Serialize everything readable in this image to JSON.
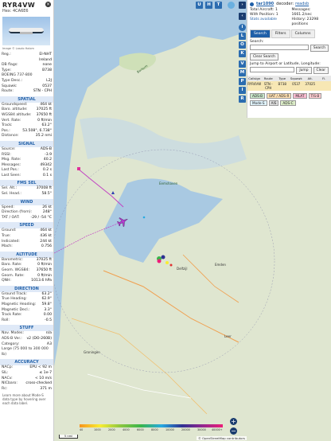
{
  "aircraft": {
    "callsign": "RYR4VW",
    "hex_label": "Hex:  4CA6E6",
    "photo_caption": "Image © Laszlo Halom"
  },
  "info_rows": [
    {
      "k": "Reg.:",
      "v": "EI-NHT"
    },
    {
      "k": "",
      "v": "Ireland"
    },
    {
      "k": "DB flags:",
      "v": "none"
    },
    {
      "k": "Type:",
      "v": "B738"
    },
    {
      "k": "BOEING 737-800",
      "v": ""
    },
    {
      "k": "Type Desc.:",
      "v": "L2J"
    },
    {
      "k": "Squawk:",
      "v": "0537"
    },
    {
      "k": "Route:",
      "v": "STN - CPH"
    }
  ],
  "sections": [
    {
      "title": "SPATIAL",
      "rows": [
        {
          "k": "Groundspeed:",
          "v": "464 kt"
        },
        {
          "k": "Baro. altitude:",
          "v": "37025 ft"
        },
        {
          "k": "WGS84 altitude:",
          "v": "37650 ft"
        },
        {
          "k": "Vert. Rate:",
          "v": "0 ft/min"
        },
        {
          "k": "Track:",
          "v": "63.2°"
        },
        {
          "k": "Pos.:",
          "v": "53.508°, 6.738°"
        },
        {
          "k": "Distance:",
          "v": "35.2 nmi"
        }
      ]
    },
    {
      "title": "SIGNAL",
      "rows": [
        {
          "k": "Source:",
          "v": "ADS-B"
        },
        {
          "k": "RSSI:",
          "v": "-3.9"
        },
        {
          "k": "Msg. Rate:",
          "v": "40.2"
        },
        {
          "k": "Messages:",
          "v": "49342"
        },
        {
          "k": "Last Pos.:",
          "v": "0.2 s"
        },
        {
          "k": "Last Seen:",
          "v": "0.1 s"
        }
      ]
    },
    {
      "title": "FMS SEL",
      "rows": [
        {
          "k": "Sel. Alt.:",
          "v": "37008 ft"
        },
        {
          "k": "Sel. Head.:",
          "v": "58.5°"
        }
      ]
    },
    {
      "title": "WIND",
      "rows": [
        {
          "k": "Speed:",
          "v": "26 kt"
        },
        {
          "k": "Direction (from):",
          "v": "248°"
        },
        {
          "k": "TAT / OAT:",
          "v": "-29 / -54 °C"
        }
      ]
    },
    {
      "title": "SPEED",
      "rows": [
        {
          "k": "Ground:",
          "v": "464 kt"
        },
        {
          "k": "True:",
          "v": "436 kt"
        },
        {
          "k": "Indicated:",
          "v": "244 kt"
        },
        {
          "k": "Mach:",
          "v": "0.756"
        }
      ]
    },
    {
      "title": "ALTITUDE",
      "rows": [
        {
          "k": "Barometric:",
          "v": "37025 ft"
        },
        {
          "k": "Baro. Rate:",
          "v": "0 ft/min"
        },
        {
          "k": "Geom. WGS84:",
          "v": "37650 ft"
        },
        {
          "k": "Geom. Rate:",
          "v": "0 ft/min"
        },
        {
          "k": "QNH:",
          "v": "1013.6 hPa"
        }
      ]
    },
    {
      "title": "DIRECTION",
      "rows": [
        {
          "k": "Ground Track:",
          "v": "63.2°"
        },
        {
          "k": "True Heading:",
          "v": "62.9°"
        },
        {
          "k": "Magnetic Heading:",
          "v": "59.8°"
        },
        {
          "k": "Magnetic Decl.:",
          "v": "3.3°"
        },
        {
          "k": "Track Rate:",
          "v": "0.00"
        },
        {
          "k": "Roll:",
          "v": "-0.5"
        }
      ]
    },
    {
      "title": "STUFF",
      "rows": [
        {
          "k": "Nav. Modes:",
          "v": "n/a"
        },
        {
          "k": "ADS-B Ver.:",
          "v": "v2 (DO-260B)"
        },
        {
          "k": "Category:",
          "v": "A3"
        },
        {
          "k": "Large (75 000 to 300 000 lb)",
          "v": ""
        }
      ]
    },
    {
      "title": "ACCURACY",
      "rows": [
        {
          "k": "NACp:",
          "v": "EPU < 92 m"
        },
        {
          "k": "SIL:",
          "v": "≤ 1e-7"
        },
        {
          "k": "NACv:",
          "v": "< 10 m/s"
        },
        {
          "k": "NICbaro:",
          "v": "cross-checked"
        },
        {
          "k": "Rc:",
          "v": "371 m"
        }
      ]
    }
  ],
  "footer_note": "Learn more about Mode-S data type by hovering over each data label.",
  "right_panel": {
    "site_name": "tar1090",
    "decoder_label": "decoder:",
    "decoder_value": "readsb",
    "total_aircraft": "Total Aircraft: 1",
    "messages": "Messages: 1661.2/sec",
    "with_position": "With Position: 1",
    "history": "History: 23298 positions",
    "stats_label": "Stats available",
    "tabs": [
      "Search",
      "Filters",
      "Columns"
    ],
    "search_label": "Search:",
    "search_button": "Search",
    "clear_search": "Clear Search",
    "jump_label": "Jump to Airport or Latitude, Longitude:",
    "jump_button": "Jump",
    "clear_button": "Clear",
    "table_headers": [
      "Callsign",
      "Route",
      "Type",
      "Squawk",
      "Alt.",
      "Fl."
    ],
    "table_row": [
      "RYR4VW",
      "STN - CPH",
      "B738",
      "0537",
      "37025",
      ""
    ],
    "badges": [
      "ADS-B",
      "UAT / ADS-R",
      "MLAT",
      "TIS-B",
      "Mode-S",
      "AIS",
      "ADS-C"
    ]
  },
  "map_buttons": [
    "U",
    "H",
    "T",
    "L",
    "O",
    "K",
    "M",
    "P",
    "I",
    "R"
  ],
  "map": {
    "labels": [
      "Eemshaven",
      "Delfzijl",
      "Borkum",
      "Emden",
      "Leer",
      "Groningen"
    ],
    "attribution": "© OpenStreetMap contributors",
    "scale": "5 nmi",
    "palette_ticks": [
      "40",
      "1000",
      "2000",
      "4000",
      "6000",
      "8000",
      "10000",
      "20000",
      "30000",
      "40000+"
    ]
  },
  "colors": {
    "accent": "#1f5fa8",
    "map_land": "#dfe6d0",
    "map_water": "#a9c9e2"
  }
}
